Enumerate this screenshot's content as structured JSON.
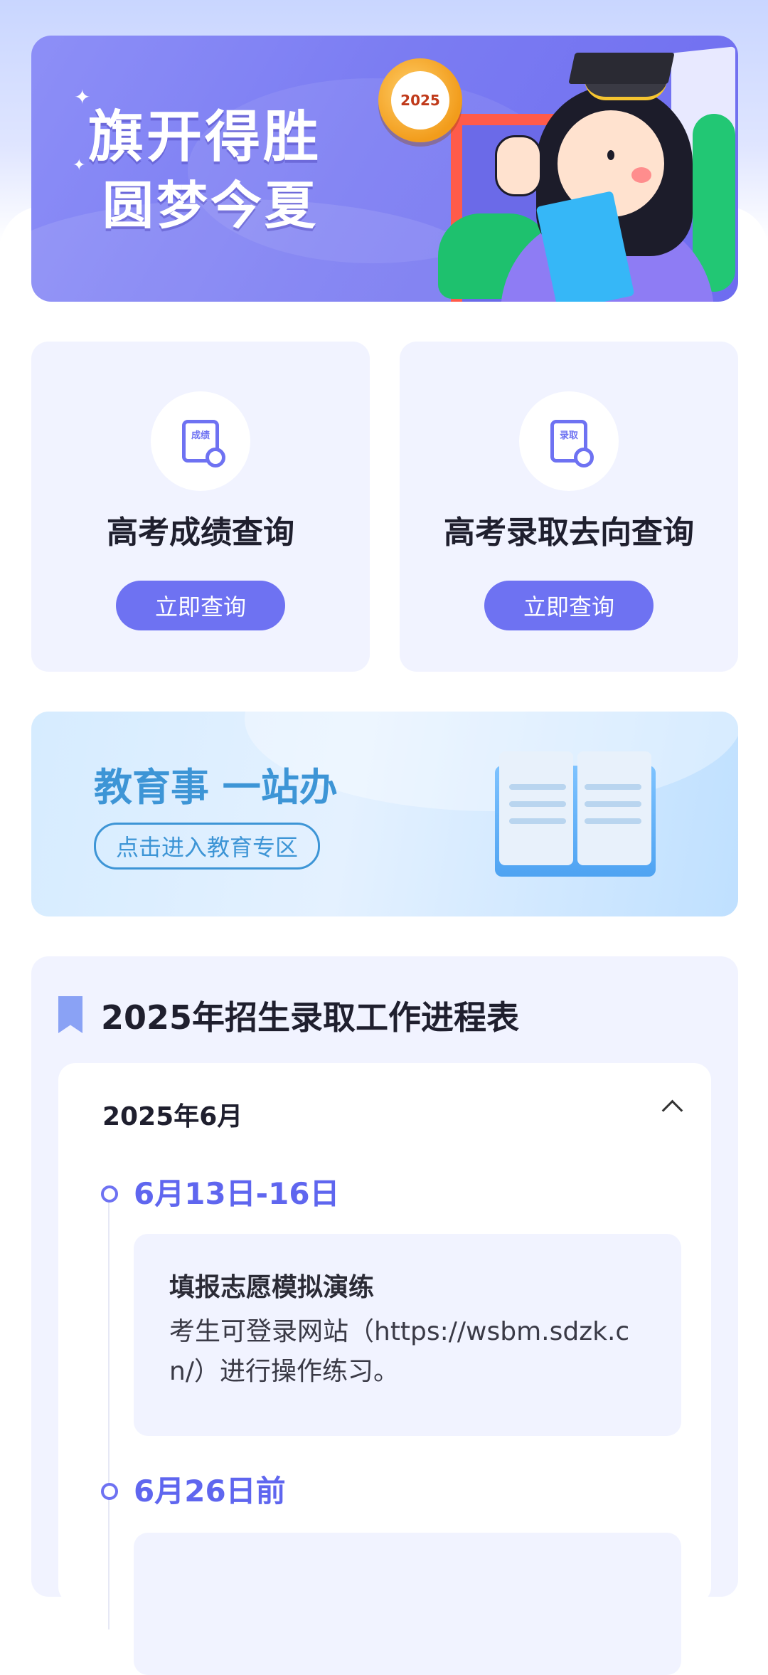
{
  "banner": {
    "slogan_line1": "旗开得胜",
    "slogan_line2": "圆梦今夏",
    "clock_year": "2025"
  },
  "query_cards": [
    {
      "title": "高考成绩查询",
      "icon_text": "成绩",
      "icon": "score-search-icon",
      "button": "立即查询"
    },
    {
      "title": "高考录取去向查询",
      "icon_text": "录取",
      "icon": "admission-search-icon",
      "button": "立即查询"
    }
  ],
  "edu": {
    "title": "教育事 一站办",
    "button": "点击进入教育专区",
    "icon": "open-book-icon"
  },
  "schedule": {
    "title": "2025年招生录取工作进程表",
    "month": "2025年6月",
    "events": [
      {
        "date": "6月13日-16日",
        "title": "填报志愿模拟演练",
        "desc": "考生可登录网站（https://wsbm.sdzk.cn/）进行操作练习。"
      },
      {
        "date": "6月26日前"
      }
    ]
  },
  "colors": {
    "accent": "#6e72f2",
    "edu_blue": "#3d95d6",
    "card_bg": "#f1f3ff"
  }
}
